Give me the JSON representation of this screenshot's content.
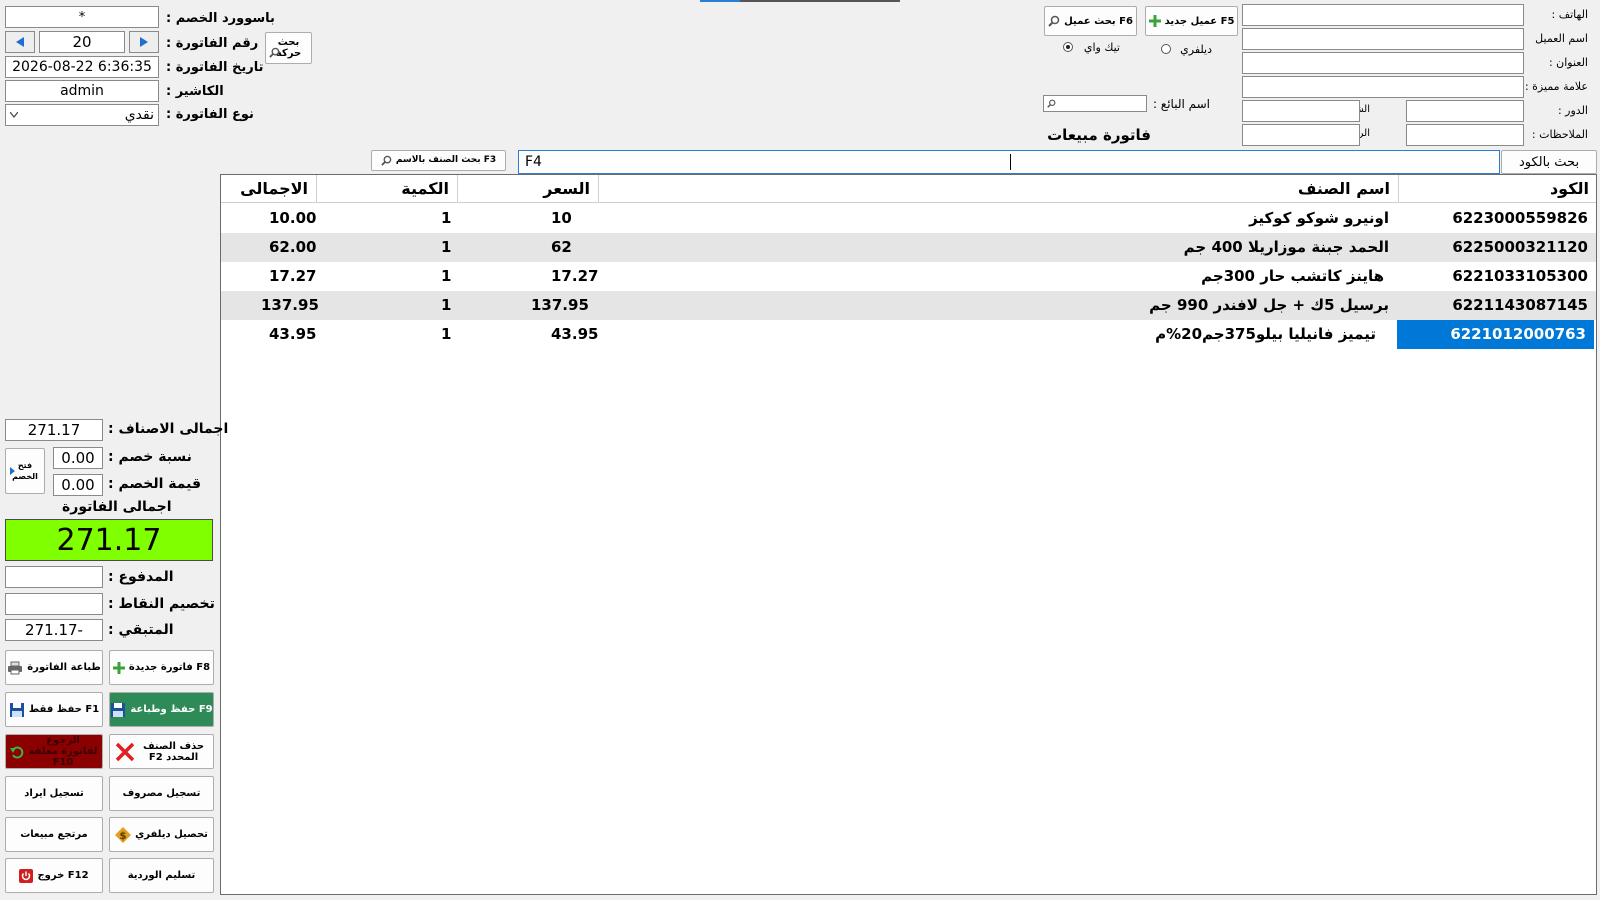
{
  "customer": {
    "phone_label": "الهاتف :",
    "name_label": "اسم العميل",
    "address_label": "العنوان :",
    "landmark_label": "علامة مميزة :",
    "floor_label": "الدور :",
    "apartment_label": "الشقة :",
    "notes_label": "الملاحظات :",
    "balance_label": "الرصيد :",
    "phone_value": "",
    "name_value": "",
    "address_value": "",
    "landmark_value": "",
    "floor_value": "",
    "apartment_value": "",
    "notes_value": "",
    "balance_value": ""
  },
  "customer_buttons": {
    "new_customer": "F5 عميل جديد",
    "search_customer": "F6 بحث عميل"
  },
  "order_type": {
    "delivery": "ديلفري",
    "takeaway": "تيك واي",
    "selected": "takeaway"
  },
  "seller": {
    "label": "اسم البائع :",
    "value": ""
  },
  "invoice_title": "فاتورة مبيعات",
  "invoice": {
    "discount_password_label": "باسوورد الخصم :",
    "discount_password_value": "*",
    "number_label": "رقم الفاتورة :",
    "number_value": "20",
    "date_label": "تاريخ الفاتورة :",
    "date_value": "2026-08-22 6:36:35",
    "cashier_label": "الكاشير :",
    "cashier_value": "admin",
    "type_label": "نوع الفاتورة :",
    "type_value": "نقدي",
    "search_movement": "بحث حركة"
  },
  "search": {
    "by_code_button": "بحث بالكود",
    "code_value": "",
    "f4_label": "F4",
    "by_name_button": "F3 بحث الصنف بالاسم"
  },
  "grid": {
    "headers": {
      "code": "الكود",
      "name": "اسم الصنف",
      "price": "السعر",
      "qty": "الكمية",
      "total": "الاجمالى"
    },
    "rows": [
      {
        "code": "6223000559826",
        "name": "اونيرو شوكو كوكيز",
        "price": "10",
        "qty": "1",
        "total": "10.00"
      },
      {
        "code": "6225000321120",
        "name": "الحمد جبنة موزاريلا 400 جم",
        "price": "62",
        "qty": "1",
        "total": "62.00"
      },
      {
        "code": "6221033105300",
        "name": "هاينز كاتشب حار 300جم",
        "price": "17.27",
        "qty": "1",
        "total": "17.27"
      },
      {
        "code": "6221143087145",
        "name": "برسيل 5ك + جل لافندر 990 جم",
        "price": "137.95",
        "qty": "1",
        "total": "137.95"
      },
      {
        "code": "6221012000763",
        "name": "تيميز فانيليا بيلو375جم20%م",
        "price": "43.95",
        "qty": "1",
        "total": "43.95"
      }
    ],
    "selected_row": 4
  },
  "totals": {
    "items_total_label": "اجمالى الاصناف :",
    "items_total_value": "271.17",
    "discount_pct_label": "نسبة خصم :",
    "discount_pct_value": "0.00",
    "discount_value_label": "قيمة الخصم :",
    "discount_value_value": "0.00",
    "open_discount": "فتح الخصم",
    "invoice_total_label": "اجمالى الفاتورة",
    "invoice_total_value": "271.17",
    "paid_label": "المدفوع :",
    "paid_value": "",
    "points_label": "تخصيم النقاط :",
    "points_value": "",
    "remaining_label": "المتبقي :",
    "remaining_value": "271.17-"
  },
  "actions": {
    "new_invoice": "F8 فاتورة جديدة",
    "print_invoice": "طباعة الفاتورة",
    "save_print": "F9 حفظ وطباعة",
    "save_only": "F1 حفظ فقط",
    "delete_item": "حذف الصنف المحدد F2",
    "return_invoice": "الرجوع لفاتورة معلقة F10",
    "record_expense": "تسجيل مصروف",
    "record_income": "تسجيل ايراد",
    "collect_delivery": "تحصيل ديلفري",
    "sales_return": "مرتجع مبيعات",
    "hand_over_shift": "تسليم الوردية",
    "exit": "F12 خروج"
  },
  "colors": {
    "total_bg": "#7fff00",
    "save_print_bg": "#2e8b57",
    "return_bg": "#8b0000",
    "selection": "#0078d7"
  }
}
